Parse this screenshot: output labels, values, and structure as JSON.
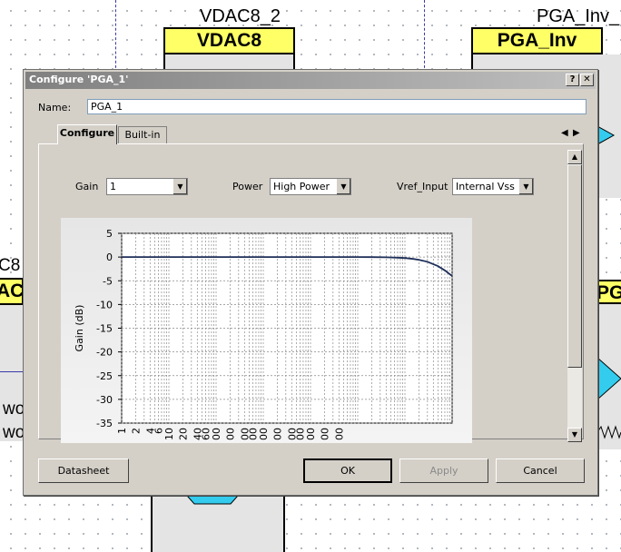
{
  "schematic": {
    "components": [
      {
        "id": "vdac8_2",
        "instance": "VDAC8_2",
        "type_label": "VDAC8"
      },
      {
        "id": "pga_inv",
        "instance": "PGA_Inv_",
        "type_label": "PGA_Inv"
      }
    ],
    "left_partial": {
      "top_text": "C8",
      "yellow_text": "AC",
      "wire_text_1": "wo",
      "wire_text_2": "wo"
    },
    "right_partial": {
      "yellow_text": "PG"
    }
  },
  "dialog": {
    "title": "Configure 'PGA_1'",
    "help_button": "?",
    "close_button": "✕",
    "name_label": "Name:",
    "name_value": "PGA_1",
    "tabs": [
      {
        "label": "Configure",
        "active": true
      },
      {
        "label": "Built-in",
        "active": false
      }
    ],
    "tab_scroll_left": "◀",
    "tab_scroll_right": "▶",
    "params": {
      "gain": {
        "label": "Gain",
        "value": "1"
      },
      "power": {
        "label": "Power",
        "value": "High Power"
      },
      "vref": {
        "label": "Vref_Input",
        "value": "Internal Vss"
      }
    },
    "buttons": {
      "datasheet": "Datasheet",
      "ok": "OK",
      "apply": "Apply",
      "cancel": "Cancel"
    }
  },
  "chart_data": {
    "type": "line",
    "title": "",
    "xlabel": "",
    "ylabel": "Gain (dB)",
    "x_scale": "log",
    "xlim": [
      1,
      10000000
    ],
    "ylim": [
      -35,
      5
    ],
    "y_ticks": [
      5,
      0,
      -5,
      -10,
      -15,
      -20,
      -25,
      -30,
      -35
    ],
    "x_tick_labels": [
      "1",
      "2",
      "4",
      "6",
      "10",
      "20",
      "40",
      "60",
      "00",
      "00",
      "00",
      "00",
      "00",
      "00",
      "00",
      "00",
      "00",
      "00",
      "00"
    ],
    "grid": true,
    "series": [
      {
        "color": "#1f2f5a",
        "x": [
          1,
          10,
          100,
          1000,
          10000,
          100000,
          200000,
          400000,
          700000,
          1000000,
          1500000,
          2000000,
          3000000,
          5000000,
          7000000,
          10000000
        ],
        "y": [
          0,
          0,
          0,
          0,
          0,
          0,
          -0.02,
          -0.05,
          -0.12,
          -0.2,
          -0.4,
          -0.6,
          -1.0,
          -1.9,
          -2.8,
          -4.0
        ]
      }
    ]
  }
}
